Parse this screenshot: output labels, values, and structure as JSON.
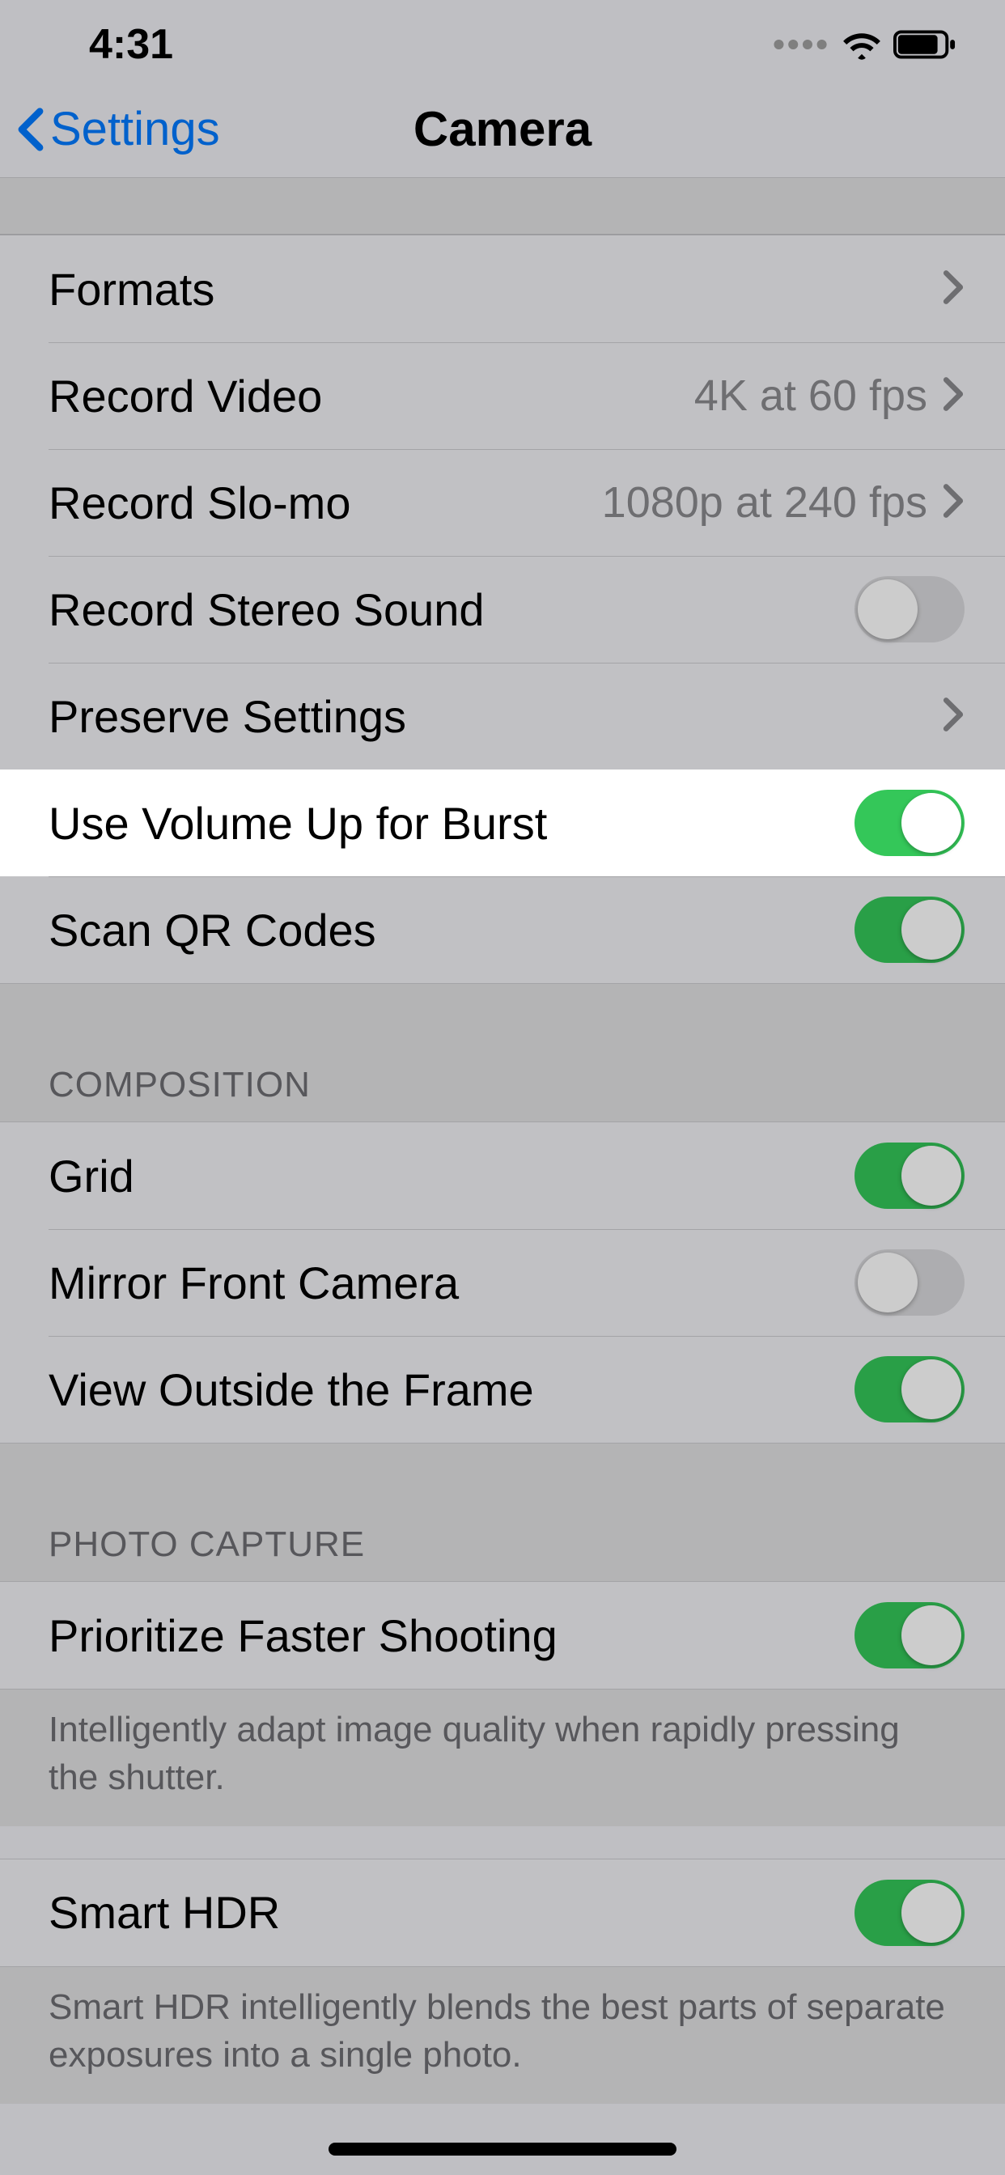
{
  "statusbar": {
    "time": "4:31"
  },
  "nav": {
    "back": "Settings",
    "title": "Camera"
  },
  "sections": {
    "main": {
      "formats": "Formats",
      "record_video": "Record Video",
      "record_video_value": "4K at 60 fps",
      "record_slomo": "Record Slo-mo",
      "record_slomo_value": "1080p at 240 fps",
      "stereo_sound": "Record Stereo Sound",
      "preserve": "Preserve Settings",
      "volume_burst": "Use Volume Up for Burst",
      "scan_qr": "Scan QR Codes"
    },
    "composition": {
      "header": "COMPOSITION",
      "grid": "Grid",
      "mirror": "Mirror Front Camera",
      "outside_frame": "View Outside the Frame"
    },
    "photo_capture": {
      "header": "PHOTO CAPTURE",
      "prioritize": "Prioritize Faster Shooting",
      "prioritize_footer": "Intelligently adapt image quality when rapidly pressing the shutter.",
      "smart_hdr": "Smart HDR",
      "smart_hdr_footer": "Smart HDR intelligently blends the best parts of separate exposures into a single photo."
    }
  },
  "toggles": {
    "stereo_sound": false,
    "volume_burst": true,
    "scan_qr": true,
    "grid": true,
    "mirror": false,
    "outside_frame": true,
    "prioritize": true,
    "smart_hdr": true
  }
}
